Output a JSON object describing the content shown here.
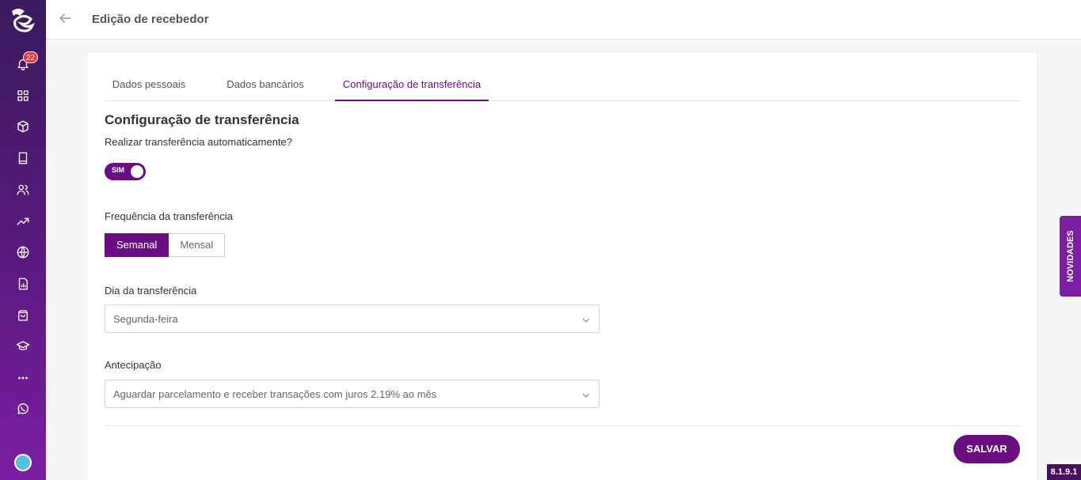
{
  "header": {
    "title": "Edição de recebedor"
  },
  "sidebar": {
    "notification_count": "22",
    "icons": [
      "bell-icon",
      "grid-icon",
      "box-icon",
      "book-icon",
      "users-icon",
      "trend-icon",
      "globe-icon",
      "report-icon",
      "bag-icon",
      "graduation-icon",
      "more-icon",
      "whatsapp-icon"
    ]
  },
  "tabs": [
    {
      "label": "Dados pessoais",
      "active": false
    },
    {
      "label": "Dados bancários",
      "active": false
    },
    {
      "label": "Configuração de transferência",
      "active": true
    }
  ],
  "form": {
    "section_title": "Configuração de transferência",
    "auto_transfer_label": "Realizar transferência automaticamente?",
    "auto_transfer_toggle": "SIM",
    "frequency_label": "Frequência da transferência",
    "frequency_options": [
      "Semanal",
      "Mensal"
    ],
    "frequency_selected": "Semanal",
    "day_label": "Dia da transferência",
    "day_value": "Segunda-feira",
    "anticipation_label": "Antecipação",
    "anticipation_value": "Aguardar parcelamento e receber transações com juros 2.19% ao mês",
    "save_label": "SALVAR"
  },
  "novidades_label": "NOVIDADES",
  "version": "8.1.9.1",
  "colors": {
    "accent": "#6a0d83",
    "sidebar_top": "#3a1a5c",
    "sidebar_bottom": "#7b1ea2"
  }
}
